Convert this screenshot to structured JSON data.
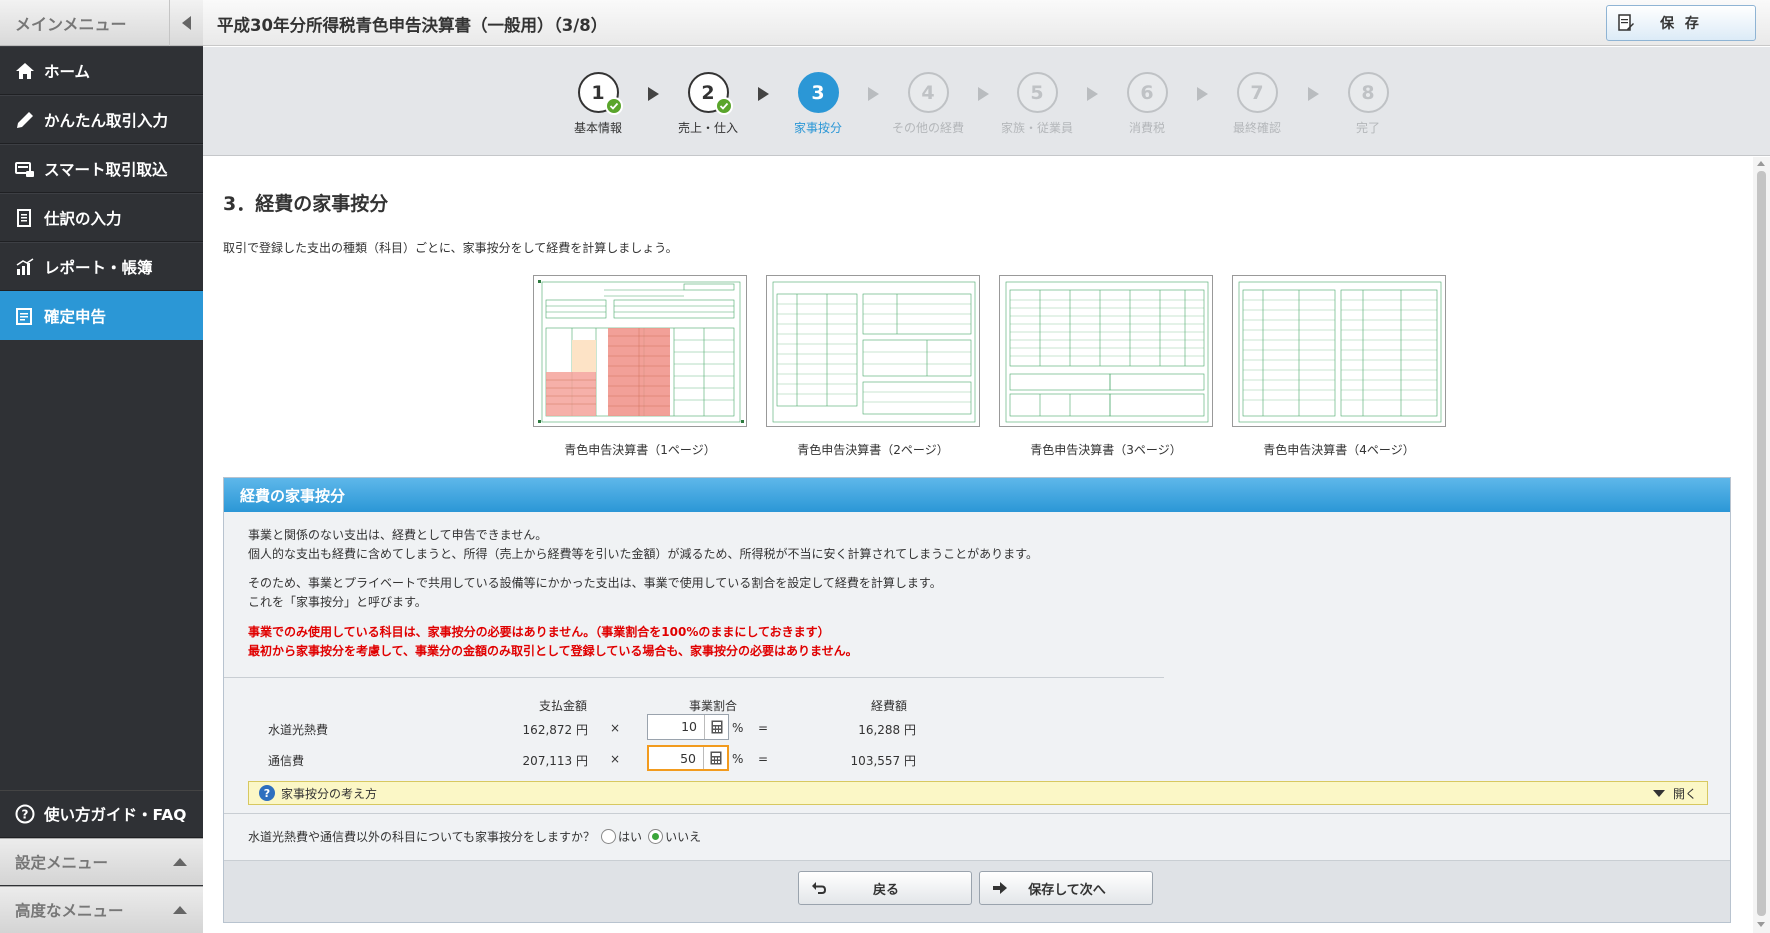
{
  "sidebar": {
    "header": "メインメニュー",
    "items": [
      {
        "label": "ホーム",
        "icon": "home-icon"
      },
      {
        "label": "かんたん取引入力",
        "icon": "pencil-icon"
      },
      {
        "label": "スマート取引取込",
        "icon": "import-card-icon"
      },
      {
        "label": "仕訳の入力",
        "icon": "journal-icon"
      },
      {
        "label": "レポート・帳簿",
        "icon": "chart-icon"
      },
      {
        "label": "確定申告",
        "icon": "tax-return-icon",
        "active": true
      }
    ],
    "guide": "使い方ガイド・FAQ",
    "settings": "設定メニュー",
    "advanced": "高度なメニュー"
  },
  "header": {
    "title": "平成30年分所得税青色申告決算書（一般用）（3/8）",
    "save_label": "保 存"
  },
  "steps": [
    {
      "num": "1",
      "label": "基本情報",
      "state": "done"
    },
    {
      "num": "2",
      "label": "売上・仕入",
      "state": "done"
    },
    {
      "num": "3",
      "label": "家事按分",
      "state": "current"
    },
    {
      "num": "4",
      "label": "その他の経費",
      "state": "future"
    },
    {
      "num": "5",
      "label": "家族・従業員",
      "state": "future"
    },
    {
      "num": "6",
      "label": "消費税",
      "state": "future"
    },
    {
      "num": "7",
      "label": "最終確認",
      "state": "future"
    },
    {
      "num": "8",
      "label": "完了",
      "state": "future"
    }
  ],
  "main": {
    "title": "3．経費の家事按分",
    "description": "取引で登録した支出の種類（科目）ごとに、家事按分をして経費を計算しましょう。",
    "thumbnails": [
      "青色申告決算書（1ページ）",
      "青色申告決算書（2ページ）",
      "青色申告決算書（3ページ）",
      "青色申告決算書（4ページ）"
    ]
  },
  "panel": {
    "title": "経費の家事按分",
    "p1_line1": "事業と関係のない支出は、経費として申告できません。",
    "p1_line2": "個人的な支出も経費に含めてしまうと、所得（売上から経費等を引いた金額）が減るため、所得税が不当に安く計算されてしまうことがあります。",
    "p2_line1": "そのため、事業とプライベートで共用している設備等にかかった支出は、事業で使用している割合を設定して経費を計算します。",
    "p2_line2": "これを「家事按分」と呼びます。",
    "red_line1": "事業でのみ使用している科目は、家事按分の必要はありません。（事業割合を100%のままにしておきます）",
    "red_line2": "最初から家事按分を考慮して、事業分の金額のみ取引として登録している場合も、家事按分の必要はありません。",
    "col_amount": "支払金額",
    "col_ratio": "事業割合",
    "col_expense": "経費額",
    "times": "×",
    "equals": "=",
    "percent": "%",
    "rows": [
      {
        "label": "水道光熱費",
        "amount": "162,872 円",
        "ratio": "10",
        "expense": "16,288 円"
      },
      {
        "label": "通信費",
        "amount": "207,113 円",
        "ratio": "50",
        "expense": "103,557 円"
      }
    ],
    "hint": "家事按分の考え方",
    "hint_open": "開く",
    "question": "水道光熱費や通信費以外の科目についても家事按分をしますか？",
    "yes": "はい",
    "no": "いいえ",
    "selected": "いいえ",
    "back": "戻る",
    "next": "保存して次へ"
  },
  "colors": {
    "accent": "#2b97d6",
    "sidebar_bg": "#2f3135",
    "warning_red": "#e00000",
    "check_green": "#5aa52c"
  }
}
